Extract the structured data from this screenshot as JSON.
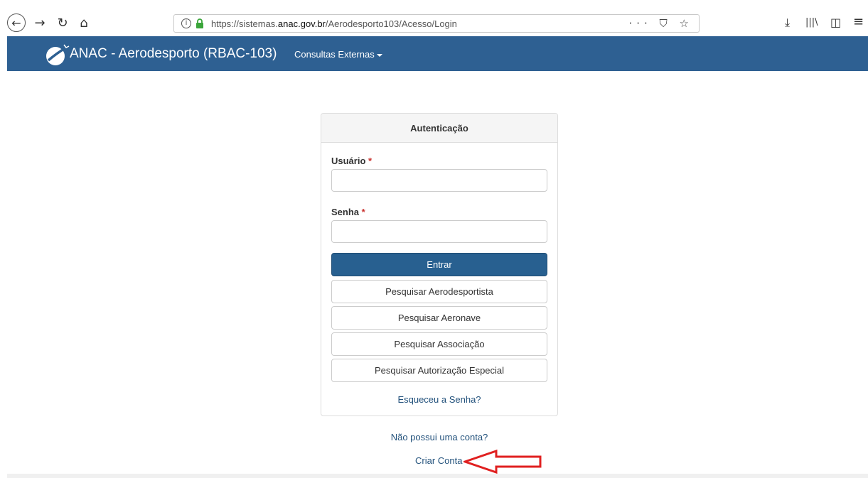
{
  "browser": {
    "back_icon": "back-arrow-icon",
    "forward_glyph": "→",
    "reload_glyph": "↻",
    "home_glyph": "⌂",
    "url_host_prefix": "https://sistemas.",
    "url_host": "anac.gov.br",
    "url_path": "/Aerodesporto103/Acesso/Login",
    "actions_glyph": "··· ⛉ ☆",
    "download_glyph": "⤓",
    "library_glyph": "|||\\",
    "sidebar_glyph": "◫",
    "menu_glyph": "≡"
  },
  "app": {
    "brand": "ANAC - Aerodesporto (RBAC-103)",
    "nav_menu": "Consultas Externas",
    "navbar_color": "#2e6092"
  },
  "login": {
    "title": "Autenticação",
    "user_label": "Usuário",
    "password_label": "Senha",
    "required_mark": "*",
    "user_value": "",
    "password_value": "",
    "submit": "Entrar",
    "buttons": [
      "Pesquisar Aerodesportista",
      "Pesquisar Aeronave",
      "Pesquisar Associação",
      "Pesquisar Autorização Especial"
    ],
    "forgot": "Esqueceu a Senha?"
  },
  "signup": {
    "question": "Não possui uma conta?",
    "create": "Criar Conta",
    "annotation_color": "#e02020"
  }
}
